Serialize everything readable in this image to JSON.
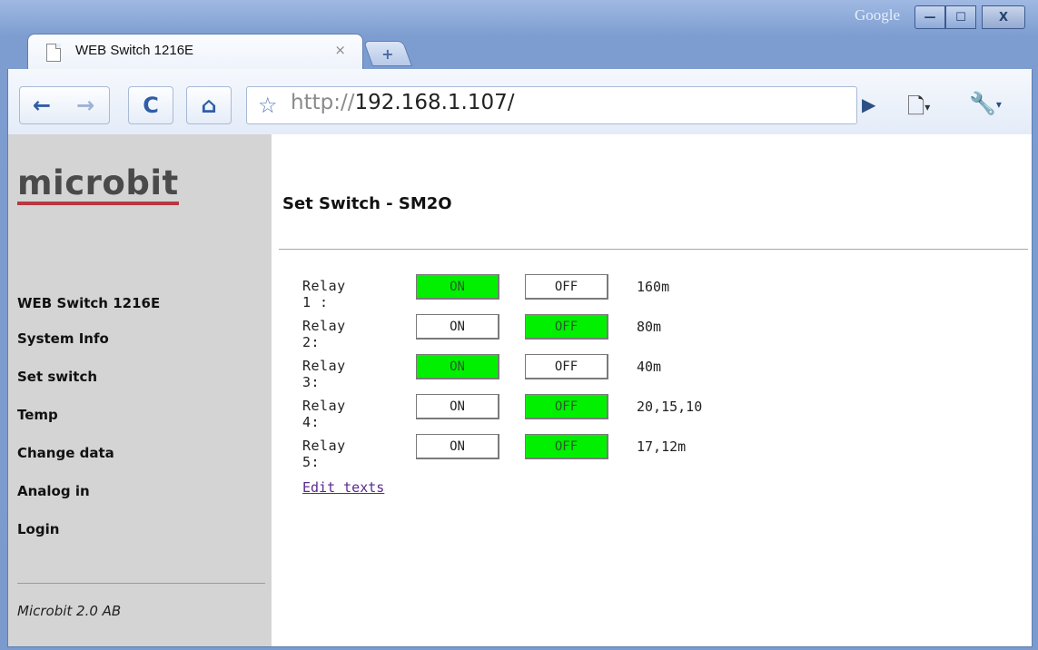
{
  "window": {
    "google_label": "Google",
    "min_glyph": "—",
    "max_glyph": "☐",
    "close_glyph": "X"
  },
  "tab": {
    "title": "WEB Switch 1216E",
    "close_glyph": "×",
    "new_tab_glyph": "+"
  },
  "toolbar": {
    "back_glyph": "←",
    "forward_glyph": "→",
    "reload_glyph": "C",
    "home_glyph": "⌂",
    "star_glyph": "☆",
    "url_scheme": "http://",
    "url_host": "192.168.1.107/",
    "go_glyph": "▶",
    "page_glyph": "🗋",
    "tools_glyph": "🔧",
    "caret": "▾"
  },
  "sidebar": {
    "logo": "microbit",
    "nav": [
      {
        "label": "WEB Switch 1216E"
      },
      {
        "label": "System Info"
      },
      {
        "label": "Set switch"
      },
      {
        "label": "Temp"
      },
      {
        "label": "Change data"
      },
      {
        "label": "Analog in"
      },
      {
        "label": "Login"
      }
    ],
    "footer": "Microbit 2.0 AB"
  },
  "main": {
    "title": "Set Switch - SM2O",
    "on_label": "ON",
    "off_label": "OFF",
    "relays": [
      {
        "label": "Relay 1 :",
        "state": "on",
        "note": "160m"
      },
      {
        "label": "Relay 2:",
        "state": "off",
        "note": "80m"
      },
      {
        "label": "Relay 3:",
        "state": "on",
        "note": "40m"
      },
      {
        "label": "Relay 4:",
        "state": "off",
        "note": "20,15,10"
      },
      {
        "label": "Relay 5:",
        "state": "off",
        "note": "17,12m"
      }
    ],
    "edit_link": "Edit texts"
  },
  "colors": {
    "active_button": "#00f000",
    "logo_underline": "#b83840",
    "sidebar_bg": "#d4d4d4",
    "link": "#5b2a8e"
  }
}
